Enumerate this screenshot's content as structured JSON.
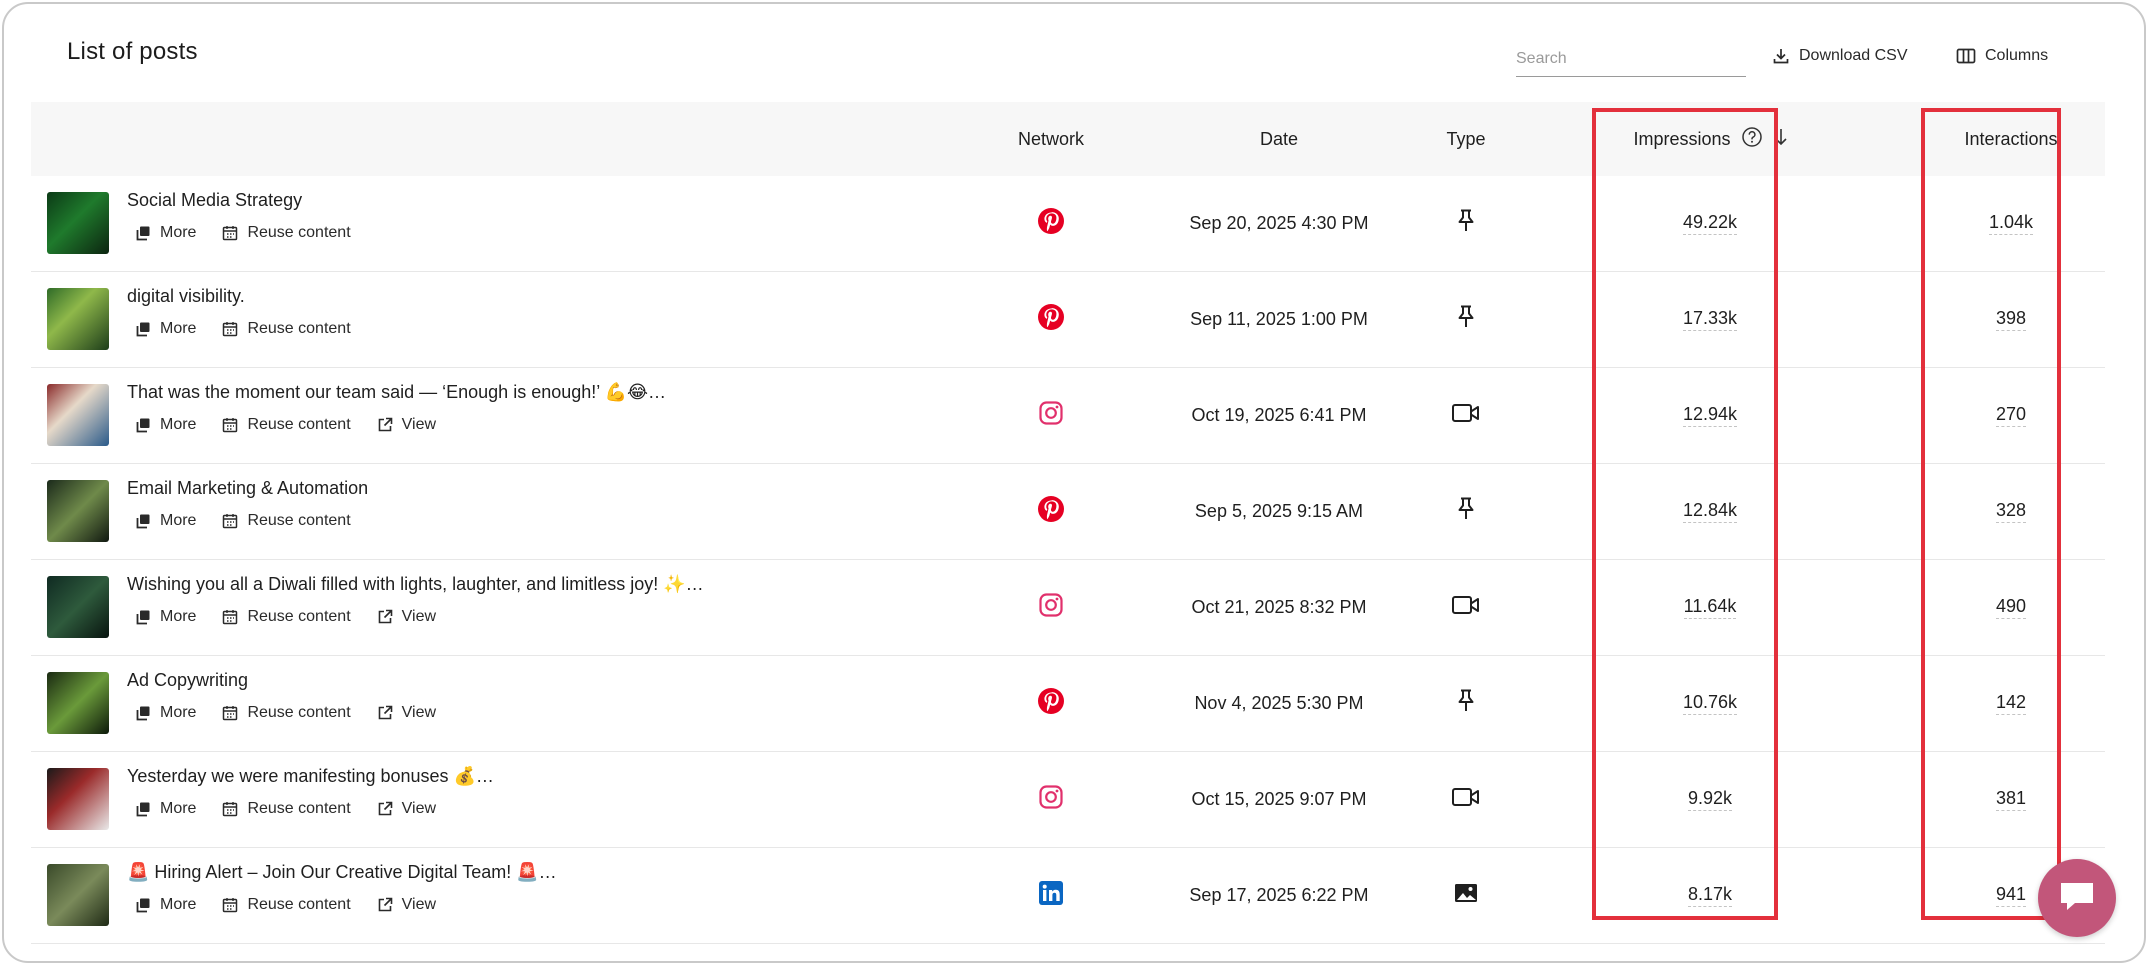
{
  "header": {
    "title": "List of posts",
    "search_placeholder": "Search",
    "download_label": "Download CSV",
    "columns_label": "Columns"
  },
  "table": {
    "columns": {
      "network": "Network",
      "date": "Date",
      "type": "Type",
      "impressions": "Impressions",
      "interactions": "Interactions"
    },
    "sort": "impressions-descending",
    "action_labels": {
      "more": "More",
      "reuse": "Reuse content",
      "view": "View"
    },
    "rows": [
      {
        "title": "Social Media Strategy",
        "network": "pinterest",
        "date": "Sep 20, 2025 4:30 PM",
        "type": "pin",
        "impressions": "49.22k",
        "interactions": "1.04k",
        "has_view": false
      },
      {
        "title": "digital visibility.",
        "network": "pinterest",
        "date": "Sep 11, 2025 1:00 PM",
        "type": "pin",
        "impressions": "17.33k",
        "interactions": "398",
        "has_view": false
      },
      {
        "title": "That was the moment our team said — ‘Enough is enough!’ 💪😂…",
        "network": "instagram",
        "date": "Oct 19, 2025 6:41 PM",
        "type": "video",
        "impressions": "12.94k",
        "interactions": "270",
        "has_view": true
      },
      {
        "title": "Email Marketing & Automation",
        "network": "pinterest",
        "date": "Sep 5, 2025 9:15 AM",
        "type": "pin",
        "impressions": "12.84k",
        "interactions": "328",
        "has_view": false
      },
      {
        "title": "Wishing you all a Diwali filled with lights, laughter, and limitless joy! ✨…",
        "network": "instagram",
        "date": "Oct 21, 2025 8:32 PM",
        "type": "video",
        "impressions": "11.64k",
        "interactions": "490",
        "has_view": true
      },
      {
        "title": "Ad Copywriting",
        "network": "pinterest",
        "date": "Nov 4, 2025 5:30 PM",
        "type": "pin",
        "impressions": "10.76k",
        "interactions": "142",
        "has_view": true
      },
      {
        "title": "Yesterday we were manifesting bonuses 💰…",
        "network": "instagram",
        "date": "Oct 15, 2025 9:07 PM",
        "type": "video",
        "impressions": "9.92k",
        "interactions": "381",
        "has_view": true
      },
      {
        "title": "🚨 Hiring Alert – Join Our Creative Digital Team! 🚨…",
        "network": "linkedin",
        "date": "Sep 17, 2025 6:22 PM",
        "type": "image",
        "impressions": "8.17k",
        "interactions": "941",
        "has_view": true
      }
    ]
  },
  "colors": {
    "pinterest": "#e60023",
    "instagram": "#e1306c",
    "linkedin": "#0a66c2",
    "highlight": "#e3303c",
    "chat": "#c2567a"
  }
}
